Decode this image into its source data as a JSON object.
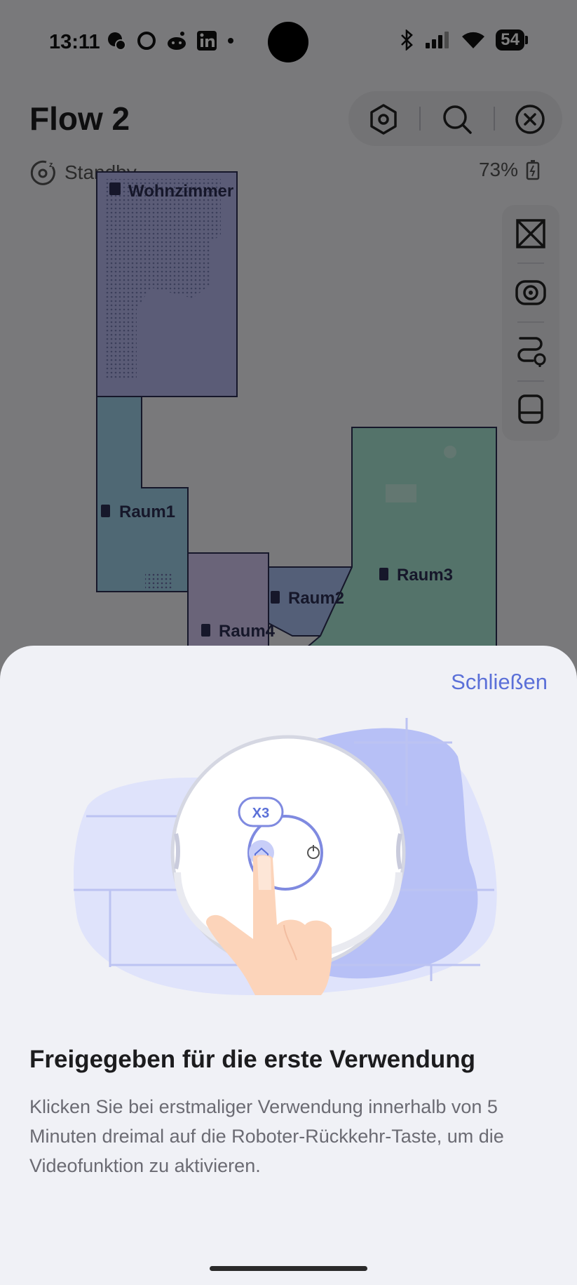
{
  "status_bar": {
    "time": "13:11",
    "battery": "54",
    "notification_icons": [
      "bug-icon",
      "circle-icon",
      "reddit-icon",
      "linkedin-icon",
      "dot-icon"
    ],
    "system_icons": [
      "bluetooth-icon",
      "signal-icon",
      "wifi-icon",
      "battery-icon"
    ]
  },
  "header": {
    "title": "Flow 2",
    "status": "Standby",
    "battery_percent": "73%",
    "tools": [
      "settings-hex-icon",
      "search-icon",
      "close-circle-icon"
    ]
  },
  "map": {
    "rooms": [
      {
        "name": "Wohnzimmer",
        "color": "#b6b9ef"
      },
      {
        "name": "Raum1",
        "color": "#9fd0e8"
      },
      {
        "name": "Raum2",
        "color": "#a9bff1"
      },
      {
        "name": "Raum3",
        "color": "#a9e6d4"
      },
      {
        "name": "Raum4",
        "color": "#d4c9f2"
      }
    ],
    "side_tools": [
      "map-edit-icon",
      "camera-icon",
      "route-icon",
      "dock-icon"
    ]
  },
  "sheet": {
    "close_label": "Schließen",
    "badge": "X3",
    "heading": "Freigegeben für die erste Verwendung",
    "description": "Klicken Sie bei erstmaliger Verwendung innerhalb von 5 Minuten dreimal auf die Roboter-Rückkehr-Taste, um die Videofunktion zu aktivieren."
  },
  "colors": {
    "accent": "#5b70d8",
    "sheet_bg": "#f0f1f6",
    "illus_light": "#dfe3fb",
    "illus_mid": "#b7c0f6"
  }
}
